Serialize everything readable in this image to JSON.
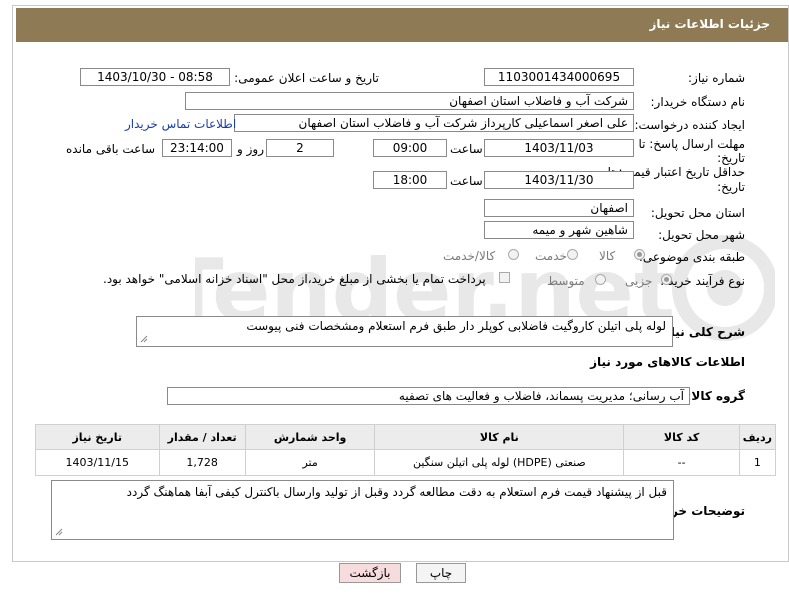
{
  "page": {
    "title": "جزئیات اطلاعات نیاز"
  },
  "fields": {
    "need_number": {
      "label": "شماره نیاز:",
      "value": "1103001434000695"
    },
    "announce_datetime": {
      "label": "تاریخ و ساعت اعلان عمومی:",
      "value": "1403/10/30 - 08:58"
    },
    "buyer_org": {
      "label": "نام دستگاه خریدار:",
      "value": "شرکت آب و فاضلاب استان اصفهان"
    },
    "requester": {
      "label": "ایجاد کننده درخواست:",
      "value": "علی اصغر اسماعیلی کارپرداز شرکت آب و فاضلاب استان اصفهان",
      "link": "اطلاعات تماس خریدار"
    },
    "response_deadline": {
      "label_line1": "مهلت ارسال پاسخ: تا",
      "label_line2": "تاریخ:",
      "date": "1403/11/03",
      "time_label": "ساعت",
      "time": "09:00",
      "days": "2",
      "days_label": "روز و",
      "remaining": "23:14:00",
      "remaining_label": "ساعت باقی مانده"
    },
    "price_validity": {
      "label_line1": "حداقل تاریخ اعتبار قیمت: تا",
      "label_line2": "تاریخ:",
      "date": "1403/11/30",
      "time_label": "ساعت",
      "time": "18:00"
    },
    "delivery_province": {
      "label": "استان محل تحویل:",
      "value": "اصفهان"
    },
    "delivery_city": {
      "label": "شهر محل تحویل:",
      "value": "شاهین شهر و میمه"
    },
    "category": {
      "label": "طبقه بندی موضوعی:",
      "options": [
        "کالا",
        "خدمت",
        "کالا/خدمت"
      ],
      "selected": "کالا"
    },
    "purchase_process": {
      "label": "نوع فرآیند خرید :",
      "options": [
        "جزیی",
        "متوسط"
      ],
      "selected": "جزیی",
      "payment_note": "پرداخت تمام یا بخشی از مبلغ خرید،از محل \"اسناد خزانه اسلامی\" خواهد بود."
    }
  },
  "general_description": {
    "label": "شرح کلی نیاز:",
    "value": "لوله پلی اتیلن کاروگیت فاضلابی کوپلر دار طبق فرم استعلام ومشخصات فنی پیوست"
  },
  "goods_section": {
    "title": "اطلاعات کالاهای مورد نیاز",
    "group_label": "گروه کالا:",
    "group_value": "آب رسانی؛ مدیریت پسماند، فاضلاب و فعالیت های تصفیه"
  },
  "goods_table": {
    "headers": [
      "ردیف",
      "کد کالا",
      "نام کالا",
      "واحد شمارش",
      "تعداد / مقدار",
      "تاریخ نیاز"
    ],
    "rows": [
      [
        "1",
        "--",
        "لوله پلی اتیلن سنگین (HDPE) صنعتی",
        "متر",
        "1,728",
        "1403/11/15"
      ]
    ]
  },
  "buyer_notes": {
    "label": "توضیحات خریدار:",
    "value": "قبل از پیشنهاد قیمت فرم استعلام به دقت مطالعه گردد وقبل از تولید وارسال باکنترل کیفی آبفا هماهنگ گردد"
  },
  "buttons": {
    "print": "چاپ",
    "back": "بازگشت"
  },
  "watermark": "AriaTender.net",
  "colors": {
    "header_bg": "#8e7a54",
    "link": "#1a3ea8",
    "back_button_bg": "#f6dcdc"
  }
}
